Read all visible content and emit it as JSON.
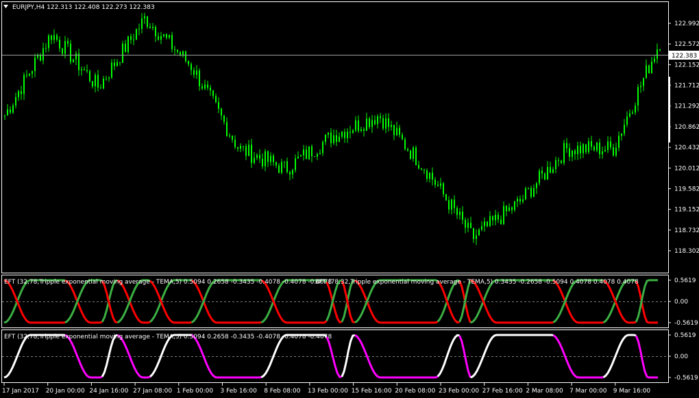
{
  "window": {
    "symbol_line": "EURJPY,H4  122.313 122.408 122.273 122.383",
    "menu_icon": "triangle-down-icon"
  },
  "main_panel": {
    "price_ticks": [
      "122.992",
      "122.572",
      "122.152",
      "121.712",
      "121.292",
      "120.862",
      "120.432",
      "120.012",
      "119.582",
      "119.152",
      "118.732",
      "118.302"
    ],
    "current_price": "122.383"
  },
  "indicator_1": {
    "label_a": "EFT (32,78,Tripple exponential moving average - TEMA,5)  0.5094 0.2658 -0.3435 -0.4078 -0.4078 -0.4078",
    "label_b": "EFT (78,32,Tripple exponential moving average - TEMA,5)  0.3435 -0.2658 -0.5094 0.4078 0.4078 0.4078",
    "ticks": [
      "0.5619",
      "0.00",
      "-0.5619"
    ]
  },
  "indicator_2": {
    "label": "EFT (32,78,Tripple exponential moving average - TEMA,5)  0.5094 0.2658 -0.3435 -0.4078 -0.4078 -0.4078",
    "ticks": [
      "0.5619",
      "0.00",
      "-0.5619"
    ]
  },
  "time_axis": [
    "17 Jan 2017",
    "20 Jan 00:00",
    "24 Jan 16:00",
    "27 Jan 08:00",
    "1 Feb 00:00",
    "3 Feb 16:00",
    "8 Feb 08:00",
    "13 Feb 00:00",
    "15 Feb 16:00",
    "20 Feb 08:00",
    "23 Feb 00:00",
    "27 Feb 16:00",
    "2 Mar 08:00",
    "7 Mar 00:00",
    "9 Mar 16:00"
  ],
  "colors": {
    "candles": "#00ff00",
    "bull_line": "#3cb043",
    "bear_line": "#ff0000",
    "up_line": "#ffffff",
    "down_line": "#ff00ff",
    "grid": "#808080"
  },
  "chart_data": [
    {
      "type": "line",
      "title": "EURJPY,H4",
      "note": "candlestick price series (approximate closes read from chart)",
      "x": [
        "17 Jan 2017",
        "20 Jan 00:00",
        "24 Jan 16:00",
        "27 Jan 08:00",
        "1 Feb 00:00",
        "3 Feb 16:00",
        "8 Feb 08:00",
        "13 Feb 00:00",
        "15 Feb 16:00",
        "20 Feb 08:00",
        "23 Feb 00:00",
        "27 Feb 16:00",
        "2 Mar 08:00",
        "7 Mar 00:00",
        "9 Mar 16:00"
      ],
      "series": [
        {
          "name": "EURJPY",
          "values": [
            120.95,
            122.55,
            121.5,
            122.85,
            121.9,
            120.3,
            119.9,
            120.55,
            120.95,
            119.9,
            118.55,
            119.25,
            120.3,
            120.3,
            122.4
          ]
        }
      ],
      "ylim": [
        118.302,
        123.15
      ],
      "last": 122.383
    },
    {
      "type": "line",
      "title": "EFT (32,78,Tripple exponential moving average - TEMA,5)",
      "ylim": [
        -0.5619,
        0.5619
      ],
      "series": [
        {
          "name": "EFT (32,78)",
          "values": [
            0.5094,
            0.2658,
            -0.3435,
            -0.4078,
            -0.4078,
            -0.4078
          ]
        },
        {
          "name": "EFT (78,32)",
          "values": [
            0.3435,
            -0.2658,
            -0.5094,
            0.4078,
            0.4078,
            0.4078
          ]
        }
      ]
    }
  ]
}
